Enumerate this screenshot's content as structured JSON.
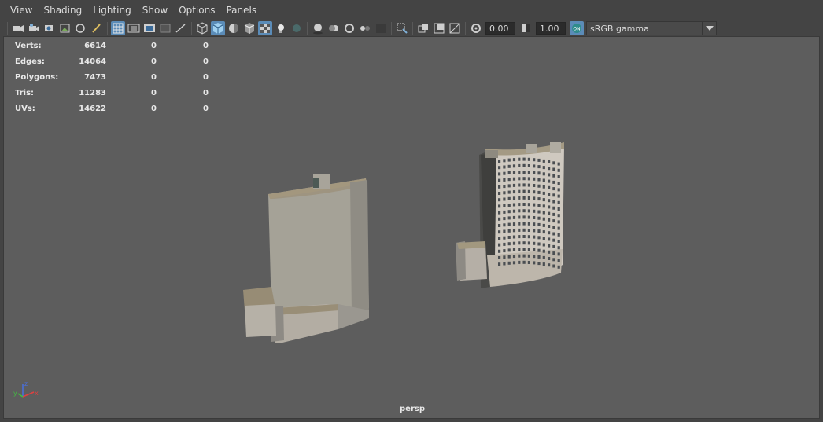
{
  "menu": {
    "items": [
      "View",
      "Shading",
      "Lighting",
      "Show",
      "Options",
      "Panels"
    ]
  },
  "toolbar": {
    "exposure_value": "0.00",
    "gamma_value": "1.00",
    "color_space": "sRGB gamma",
    "icons": [
      "select-camera-icon",
      "camera-attributes-icon",
      "bookmarks-icon",
      "image-plane-icon",
      "2d-pan-zoom-icon",
      "grease-pencil-icon",
      "grid-icon",
      "film-gate-icon",
      "resolution-gate-icon",
      "gate-mask-icon",
      "field-chart-icon",
      "wireframe-icon",
      "smooth-shade-icon",
      "use-default-material-icon",
      "wireframe-on-shaded-icon",
      "xray-icon",
      "use-all-lights-icon",
      "shadows-icon",
      "screen-space-ao-icon",
      "motion-blur-icon",
      "multisample-aa-icon",
      "depth-of-field-icon",
      "isolate-select-icon",
      "xray-joints-icon",
      "xray-active-components-icon",
      "hud-icon",
      "exposure-icon",
      "gamma-icon",
      "color-management-icon"
    ]
  },
  "hud": {
    "rows": [
      {
        "label": "Verts:",
        "v1": "6614",
        "v2": "0",
        "v3": "0"
      },
      {
        "label": "Edges:",
        "v1": "14064",
        "v2": "0",
        "v3": "0"
      },
      {
        "label": "Polygons:",
        "v1": "7473",
        "v2": "0",
        "v3": "0"
      },
      {
        "label": "Tris:",
        "v1": "11283",
        "v2": "0",
        "v3": "0"
      },
      {
        "label": "UVs:",
        "v1": "14622",
        "v2": "0",
        "v3": "0"
      }
    ]
  },
  "viewport": {
    "camera_name": "persp",
    "axis_labels": {
      "x": "x",
      "y": "y",
      "z": "z"
    },
    "colors": {
      "background": "#5d5d5d",
      "building_wall": "#aaa69c",
      "roof": "#9e9480",
      "window": "#4a4e52"
    }
  }
}
